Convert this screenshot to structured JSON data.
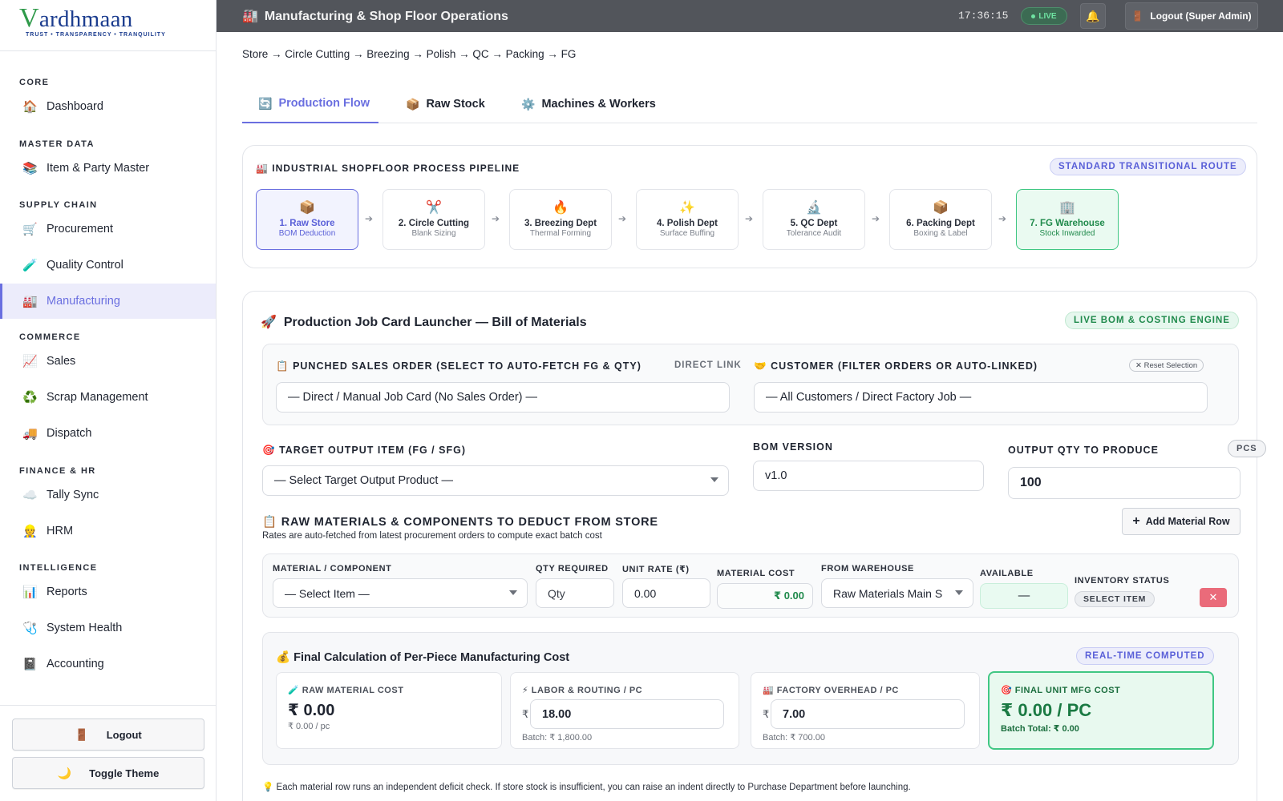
{
  "brand": {
    "logo_letter": "V",
    "logo_rest": "ardhmaan",
    "tagline": "TRUST • TRANSPARENCY • TRANQUILITY"
  },
  "sidebar": {
    "sections": [
      {
        "title": "CORE",
        "items": [
          {
            "label": "Dashboard",
            "icon": "🏠"
          }
        ]
      },
      {
        "title": "MASTER DATA",
        "items": [
          {
            "label": "Item & Party Master",
            "icon": "📚"
          }
        ]
      },
      {
        "title": "SUPPLY CHAIN",
        "items": [
          {
            "label": "Procurement",
            "icon": "🛒"
          },
          {
            "label": "Quality Control",
            "icon": "🧪"
          },
          {
            "label": "Manufacturing",
            "icon": "🏭"
          }
        ]
      },
      {
        "title": "COMMERCE",
        "items": [
          {
            "label": "Sales",
            "icon": "📈"
          },
          {
            "label": "Scrap Management",
            "icon": "♻️"
          },
          {
            "label": "Dispatch",
            "icon": "🚚"
          }
        ]
      },
      {
        "title": "FINANCE & HR",
        "items": [
          {
            "label": "Tally Sync",
            "icon": "☁️"
          },
          {
            "label": "HRM",
            "icon": "👷"
          }
        ]
      },
      {
        "title": "INTELLIGENCE",
        "items": [
          {
            "label": "Reports",
            "icon": "📊"
          },
          {
            "label": "System Health",
            "icon": "🩺"
          },
          {
            "label": "Accounting",
            "icon": "📓"
          }
        ]
      }
    ],
    "active_item": "Manufacturing",
    "logout_label": "Logout",
    "logout_icon": "🚪",
    "theme_label": "Toggle Theme",
    "theme_icon": "🌙"
  },
  "topbar": {
    "title": "Manufacturing & Shop Floor Operations",
    "title_icon": "🏭",
    "clock": "17:36:15",
    "live_label": "LIVE",
    "bell_icon": "🔔",
    "logout_label": "Logout (Super Admin)",
    "logout_icon": "🚪"
  },
  "breadcrumb": "Store → Circle Cutting → Breezing → Polish → QC → Packing → FG",
  "tabs": [
    {
      "label": "Production Flow",
      "icon": "🔄",
      "active": true
    },
    {
      "label": "Raw Stock",
      "icon": "📦",
      "active": false
    },
    {
      "label": "Machines & Workers",
      "icon": "⚙️",
      "active": false
    }
  ],
  "pipeline": {
    "title": "INDUSTRIAL SHOPFLOOR PROCESS PIPELINE",
    "title_icon": "🏭",
    "badge": "STANDARD TRANSITIONAL ROUTE",
    "steps": [
      {
        "icon": "📦",
        "title": "1. Raw Store",
        "subtitle": "BOM Deduction"
      },
      {
        "icon": "✂️",
        "title": "2. Circle Cutting",
        "subtitle": "Blank Sizing"
      },
      {
        "icon": "🔥",
        "title": "3. Breezing Dept",
        "subtitle": "Thermal Forming"
      },
      {
        "icon": "✨",
        "title": "4. Polish Dept",
        "subtitle": "Surface Buffing"
      },
      {
        "icon": "🔬",
        "title": "5. QC Dept",
        "subtitle": "Tolerance Audit"
      },
      {
        "icon": "📦",
        "title": "6. Packing Dept",
        "subtitle": "Boxing & Label"
      },
      {
        "icon": "🏢",
        "title": "7. FG Warehouse",
        "subtitle": "Stock Inwarded"
      }
    ],
    "arrow": "➔"
  },
  "launcher": {
    "title": "Production Job Card Launcher — Bill of Materials",
    "title_icon": "🚀",
    "badge": "LIVE BOM & COSTING ENGINE",
    "sales_order": {
      "icon": "📋",
      "label": "PUNCHED SALES ORDER (SELECT TO AUTO-FETCH FG & QTY)",
      "link": "DIRECT LINK",
      "value": "— Direct / Manual Job Card (No Sales Order) —"
    },
    "customer": {
      "icon": "🤝",
      "label": "CUSTOMER (FILTER ORDERS OR AUTO-LINKED)",
      "reset": "Reset Selection",
      "reset_icon": "✕",
      "value": "— All Customers / Direct Factory Job —"
    },
    "target": {
      "icon": "🎯",
      "label": "TARGET OUTPUT ITEM (FG / SFG)",
      "value": "— Select Target Output Product —"
    },
    "bom": {
      "label": "BOM VERSION",
      "value": "v1.0"
    },
    "qty": {
      "label": "OUTPUT QTY TO PRODUCE",
      "unit": "PCS",
      "value": "100"
    }
  },
  "materials": {
    "title": "RAW MATERIALS & COMPONENTS TO DEDUCT FROM STORE",
    "title_icon": "📋",
    "subtitle": "Rates are auto-fetched from latest procurement orders to compute exact batch cost",
    "add_label": "Add Material Row",
    "add_icon": "+",
    "columns": {
      "material": "MATERIAL / COMPONENT",
      "qty": "QTY REQUIRED",
      "rate": "UNIT RATE (₹)",
      "cost": "MATERIAL COST",
      "warehouse": "FROM WAREHOUSE",
      "available": "AVAILABLE",
      "status": "INVENTORY STATUS"
    },
    "row": {
      "material": "— Select Item —",
      "qty_placeholder": "Qty",
      "rate": "0.00",
      "cost": "₹ 0.00",
      "warehouse": "Raw Materials Main S",
      "available": "—",
      "status": "SELECT ITEM",
      "delete_icon": "✕"
    }
  },
  "costing": {
    "title": "Final Calculation of Per-Piece Manufacturing Cost",
    "title_icon": "💰",
    "badge": "REAL-TIME COMPUTED",
    "raw": {
      "icon": "🧪",
      "label": "RAW MATERIAL COST",
      "value": "₹ 0.00",
      "sub": "₹ 0.00 / pc"
    },
    "labor": {
      "icon": "⚡",
      "label": "LABOR & ROUTING / PC",
      "currency": "₹",
      "value": "18.00",
      "batch": "Batch: ₹ 1,800.00"
    },
    "overhead": {
      "icon": "🏭",
      "label": "FACTORY OVERHEAD / PC",
      "currency": "₹",
      "value": "7.00",
      "batch": "Batch: ₹ 700.00"
    },
    "final": {
      "icon": "🎯",
      "label": "FINAL UNIT MFG COST",
      "value": "₹ 0.00 / PC",
      "batch": "Batch Total: ₹ 0.00"
    }
  },
  "footnote": {
    "icon": "💡",
    "text": "Each material row runs an independent deficit check. If store stock is insufficient, you can raise an indent directly to Purchase Department before launching."
  }
}
